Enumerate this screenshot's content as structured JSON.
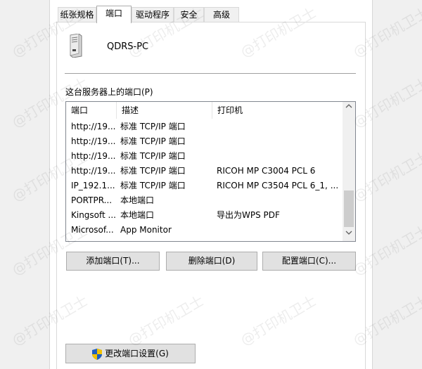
{
  "tabs": [
    {
      "label": "纸张规格"
    },
    {
      "label": "端口"
    },
    {
      "label": "驱动程序"
    },
    {
      "label": "安全"
    },
    {
      "label": "高级"
    }
  ],
  "server": {
    "name": "QDRS-PC"
  },
  "ports_label": "这台服务器上的端口(P)",
  "list": {
    "columns": [
      "端口",
      "描述",
      "打印机"
    ],
    "rows": [
      {
        "port": "http://19...",
        "desc": "标准 TCP/IP 端口",
        "printer": ""
      },
      {
        "port": "http://19...",
        "desc": "标准 TCP/IP 端口",
        "printer": ""
      },
      {
        "port": "http://19...",
        "desc": "标准 TCP/IP 端口",
        "printer": ""
      },
      {
        "port": "http://19...",
        "desc": "标准 TCP/IP 端口",
        "printer": "RICOH MP C3004 PCL 6"
      },
      {
        "port": "IP_192.1...",
        "desc": "标准 TCP/IP 端口",
        "printer": "RICOH MP C3504 PCL 6_1, ..."
      },
      {
        "port": "PORTPR...",
        "desc": "本地端口",
        "printer": ""
      },
      {
        "port": "Kingsoft ...",
        "desc": "本地端口",
        "printer": "导出为WPS PDF"
      },
      {
        "port": "Microsof...",
        "desc": "App Monitor",
        "printer": ""
      }
    ]
  },
  "buttons": {
    "add": "添加端口(T)...",
    "delete": "删除端口(D)",
    "configure": "配置端口(C)...",
    "change_settings": "更改端口设置(G)"
  },
  "watermark": "@打印机卫士",
  "icons": {
    "server": "server-icon",
    "shield": "uac-shield-icon",
    "scroll_up": "chevron-up-icon",
    "scroll_down": "chevron-down-icon"
  }
}
